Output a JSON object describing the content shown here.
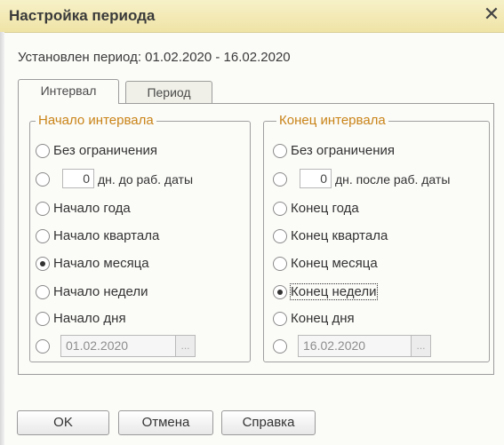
{
  "dialog": {
    "title": "Настройка периода",
    "close_symbol": "✕",
    "status_text": "Установлен период: 01.02.2020 - 16.02.2020"
  },
  "tabs": [
    {
      "label": "Интервал",
      "active": true
    },
    {
      "label": "Период",
      "active": false
    }
  ],
  "start_group": {
    "legend": "Начало интервала",
    "options": {
      "no_limit": "Без ограничения",
      "days_value": "0",
      "days_label": "дн. до раб. даты",
      "year": "Начало года",
      "quarter": "Начало квартала",
      "month": "Начало месяца",
      "week": "Начало недели",
      "day": "Начало дня",
      "date_value": "01.02.2020",
      "date_button": "..."
    },
    "selected": "month"
  },
  "end_group": {
    "legend": "Конец интервала",
    "options": {
      "no_limit": "Без ограничения",
      "days_value": "0",
      "days_label": "дн. после раб. даты",
      "year": "Конец года",
      "quarter": "Конец квартала",
      "month": "Конец месяца",
      "week": "Конец недели",
      "day": "Конец дня",
      "date_value": "16.02.2020",
      "date_button": "..."
    },
    "selected": "week"
  },
  "buttons": {
    "ok": "OK",
    "cancel": "Отмена",
    "help": "Справка"
  },
  "colors": {
    "titlebar": "#f2e9b6",
    "legend": "#c98418",
    "background": "#fbfbf8"
  }
}
